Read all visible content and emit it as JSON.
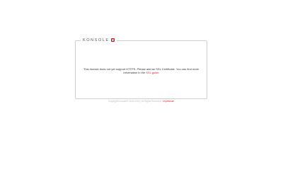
{
  "brand": {
    "name": "KONSOLE",
    "mark_color": "#d8232a",
    "mark_icon": "swiss-cross-icon"
  },
  "message": {
    "text_before": "This domain does not yet support HTTPS. Please add an SSL Certificate. You can find more information in the",
    "link_label": "SSL guide"
  },
  "footer": {
    "copyright": "Copyright Konsole® 2004-2025 | All Rights Reserved |",
    "impressum_label": "Impressum"
  },
  "colors": {
    "accent": "#d8232a",
    "border": "#cfcfcf",
    "footer_text": "#bbbbbb"
  }
}
